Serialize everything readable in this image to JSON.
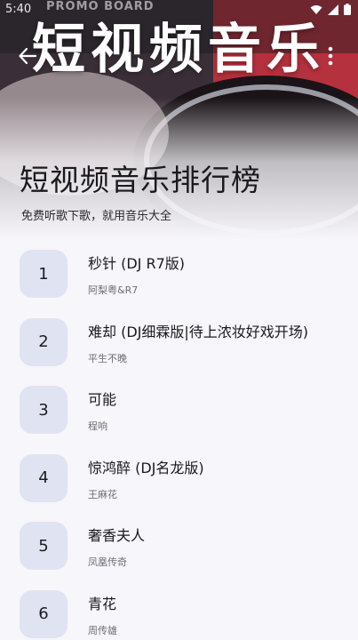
{
  "status_bar": {
    "time": "5:40",
    "carrier": "PROMO BOARD"
  },
  "header": {
    "banner_text": "短视频音乐",
    "title": "短视频音乐排行榜",
    "subtitle": "免费听歌下歌，就用音乐大全"
  },
  "icons": {
    "back": "arrow-left-icon",
    "more": "more-vertical-icon",
    "wifi": "wifi-icon",
    "signal": "signal-icon",
    "battery": "battery-icon"
  },
  "colors": {
    "badge_background": "#dfe3f2",
    "page_background": "#f7f6fa"
  },
  "songs": [
    {
      "rank": "1",
      "title": "秒针 (DJ R7版)",
      "artist": "阿梨粤&R7"
    },
    {
      "rank": "2",
      "title": "难却 (DJ细霖版|待上浓妆好戏开场)",
      "artist": "平生不晚"
    },
    {
      "rank": "3",
      "title": "可能",
      "artist": "程响"
    },
    {
      "rank": "4",
      "title": "惊鸿醉 (DJ名龙版)",
      "artist": "王麻花"
    },
    {
      "rank": "5",
      "title": "奢香夫人",
      "artist": "凤凰传奇"
    },
    {
      "rank": "6",
      "title": "青花",
      "artist": "周传雄"
    }
  ]
}
